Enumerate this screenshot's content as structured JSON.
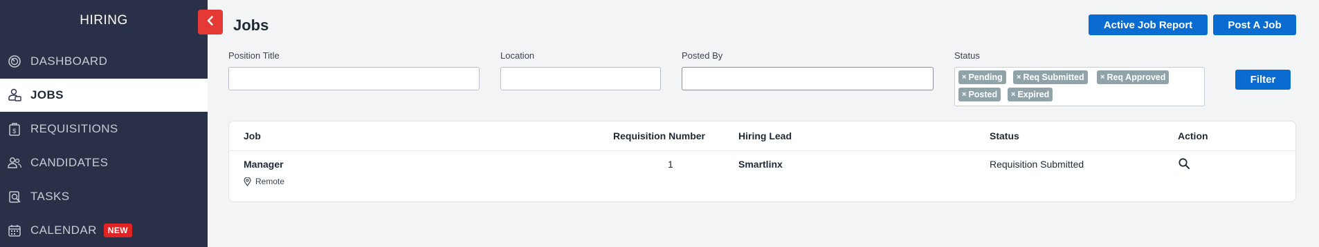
{
  "sidebar": {
    "title": "HIRING",
    "items": [
      {
        "label": "DASHBOARD",
        "icon": "dashboard-icon"
      },
      {
        "label": "JOBS",
        "icon": "jobs-icon",
        "active": true
      },
      {
        "label": "REQUISITIONS",
        "icon": "requisitions-icon"
      },
      {
        "label": "CANDIDATES",
        "icon": "candidates-icon"
      },
      {
        "label": "TASKS",
        "icon": "tasks-icon"
      },
      {
        "label": "CALENDAR",
        "icon": "calendar-icon",
        "badge": "NEW"
      }
    ]
  },
  "header": {
    "title": "Jobs",
    "active_job_report_label": "Active Job Report",
    "post_job_label": "Post A Job"
  },
  "filters": {
    "position_title_label": "Position Title",
    "position_title_value": "",
    "location_label": "Location",
    "location_value": "",
    "posted_by_label": "Posted By",
    "posted_by_value": "",
    "status_label": "Status",
    "status_chips": [
      "Pending",
      "Req Submitted",
      "Req Approved",
      "Posted",
      "Expired"
    ],
    "filter_button_label": "Filter"
  },
  "table": {
    "columns": [
      "Job",
      "Requisition Number",
      "Hiring Lead",
      "Status",
      "Action"
    ],
    "rows": [
      {
        "job": "Manager",
        "location": "Remote",
        "requisition_number": "1",
        "hiring_lead": "Smartlinx",
        "status": "Requisition Submitted",
        "action_icon": "search-icon"
      }
    ]
  },
  "colors": {
    "sidebar_bg": "#2a3047",
    "accent_blue": "#0a6bd0",
    "collapse_red": "#e53935",
    "chip_gray": "#8fa3a8",
    "badge_red": "#e02424"
  }
}
